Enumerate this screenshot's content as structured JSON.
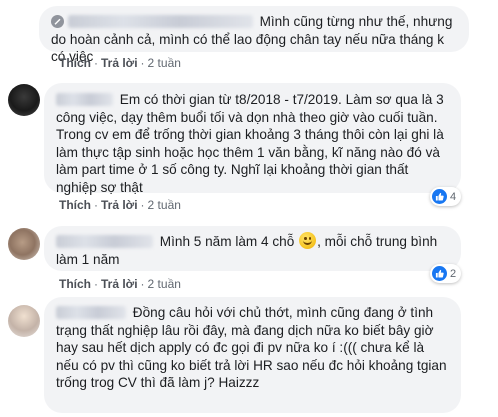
{
  "colors": {
    "bubble": "#f2f3f5",
    "link": "#4b4f56",
    "like": "#1877f2"
  },
  "comments": [
    {
      "text": "Mình cũng từng như thế, nhưng do hoàn cảnh cả, mình có thể lao động chân tay nếu nữa tháng k có việc",
      "actions": {
        "like": "Thích",
        "reply": "Trả lời",
        "time": "2 tuần"
      }
    },
    {
      "text": "Em có thời gian từ t8/2018 - t7/2019. Làm sơ qua là 3 công việc, dạy thêm buổi tối và dọn nhà theo giờ vào cuối tuần. Trong cv em để trống thời gian khoảng 3 tháng thôi còn lại ghi là làm thực tập sinh hoặc học thêm 1 văn bằng, kĩ năng nào đó và làm part time ở 1 số công ty. Nghĩ lại khoảng thời gian thất nghiệp sợ thật",
      "actions": {
        "like": "Thích",
        "reply": "Trả lời",
        "time": "2 tuần"
      },
      "reaction": {
        "icon": "like-icon",
        "count": "4"
      }
    },
    {
      "text_before": "Mình 5 năm làm 4 chỗ",
      "emoji": "smiling-face-emoji",
      "text_after": ", mỗi chỗ trung bình làm 1 năm",
      "actions": {
        "like": "Thích",
        "reply": "Trả lời",
        "time": "2 tuần"
      },
      "reaction": {
        "icon": "like-icon",
        "count": "2"
      }
    },
    {
      "text": "Đồng câu hỏi với chủ thớt, mình cũng đang ở tình trạng thất nghiệp lâu rồi đây, mà đang dịch nữa ko biết bây giờ hay sau hết dịch apply có đc gọi đi pv nữa ko í :((( chưa kể là nếu có pv thì cũng ko biết trả lời HR sao nếu đc hỏi khoảng tgian trống trog CV thì đã làm j? Haizzz"
    }
  ]
}
